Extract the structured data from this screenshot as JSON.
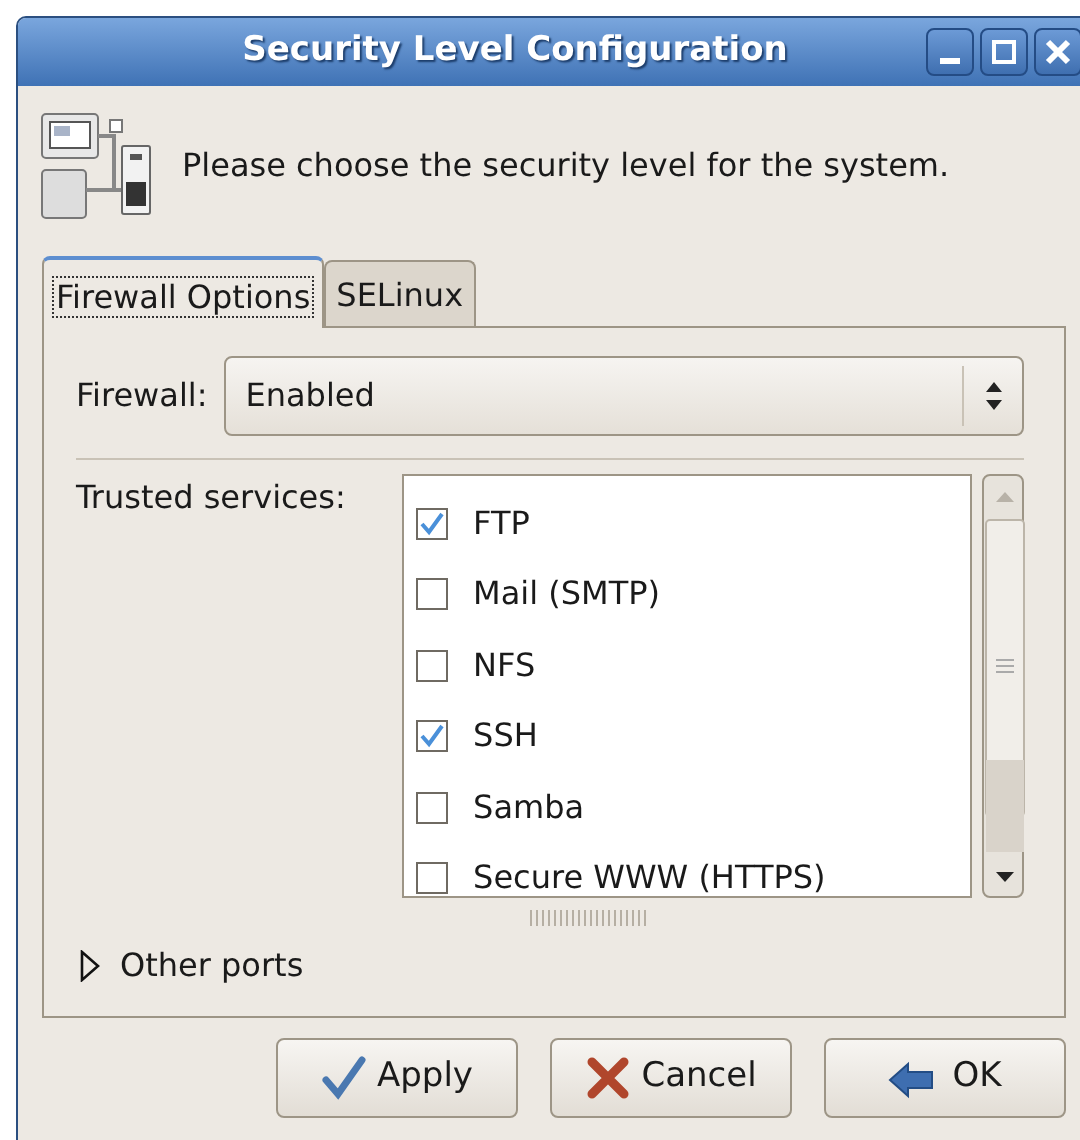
{
  "window": {
    "title": "Security Level Configuration"
  },
  "header": {
    "text": "Please choose the security level for the system."
  },
  "tabs": [
    {
      "label": "Firewall Options",
      "selected": true
    },
    {
      "label": "SELinux",
      "selected": false
    }
  ],
  "firewall": {
    "label": "Firewall:",
    "value": "Enabled"
  },
  "trusted_services": {
    "label": "Trusted services:",
    "items": [
      {
        "label": "FTP",
        "checked": true
      },
      {
        "label": "Mail (SMTP)",
        "checked": false
      },
      {
        "label": "NFS",
        "checked": false
      },
      {
        "label": "SSH",
        "checked": true
      },
      {
        "label": "Samba",
        "checked": false
      },
      {
        "label": "Secure WWW (HTTPS)",
        "checked": false
      }
    ]
  },
  "other_ports": {
    "label": "Other ports",
    "expanded": false
  },
  "buttons": [
    {
      "label": "Apply",
      "kind": "apply"
    },
    {
      "label": "Cancel",
      "kind": "cancel"
    },
    {
      "label": "OK",
      "kind": "ok"
    }
  ]
}
